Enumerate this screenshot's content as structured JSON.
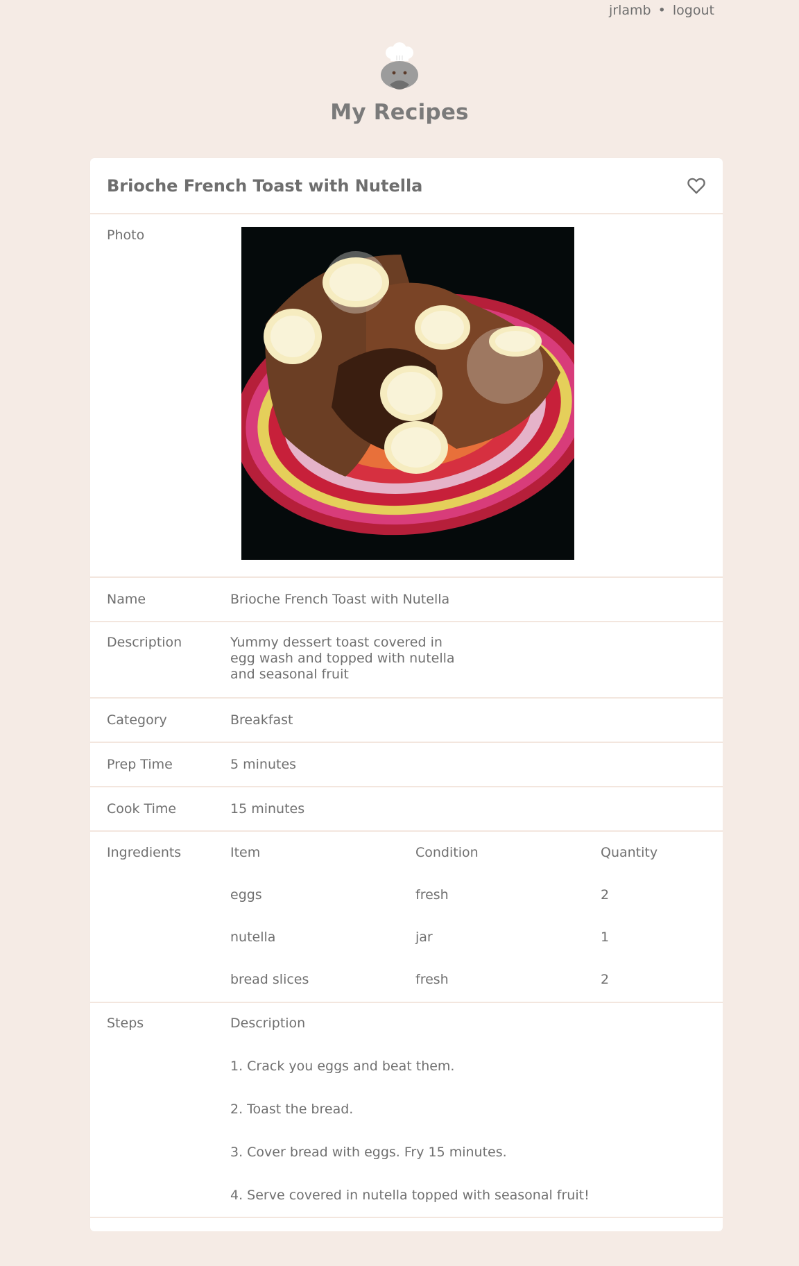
{
  "topbar": {
    "username": "jrlamb",
    "separator": "•",
    "logout": "logout"
  },
  "brand": {
    "title": "My Recipes"
  },
  "recipe": {
    "title": "Brioche French Toast with Nutella",
    "labels": {
      "photo": "Photo",
      "name": "Name",
      "description": "Description",
      "category": "Category",
      "prep_time": "Prep Time",
      "cook_time": "Cook Time",
      "ingredients": "Ingredients",
      "steps": "Steps"
    },
    "name": "Brioche French Toast with Nutella",
    "description": "Yummy dessert toast covered in egg wash and topped with nutella and seasonal fruit",
    "category": "Breakfast",
    "prep_time": "5 minutes",
    "cook_time": "15 minutes",
    "ingredients": {
      "headers": [
        "Item",
        "Condition",
        "Quantity"
      ],
      "rows": [
        [
          "eggs",
          "fresh",
          "2"
        ],
        [
          "nutella",
          "jar",
          "1"
        ],
        [
          "bread slices",
          "fresh",
          "2"
        ]
      ]
    },
    "steps": {
      "header": "Description",
      "items": [
        "1. Crack you eggs and beat them.",
        "2. Toast the bread.",
        "3. Cover bread with eggs. Fry 15 minutes.",
        "4. Serve covered in nutella topped with seasonal fruit!"
      ]
    }
  },
  "icons": {
    "favorite": "heart-outline-icon",
    "logo": "chef-hat-logo"
  }
}
